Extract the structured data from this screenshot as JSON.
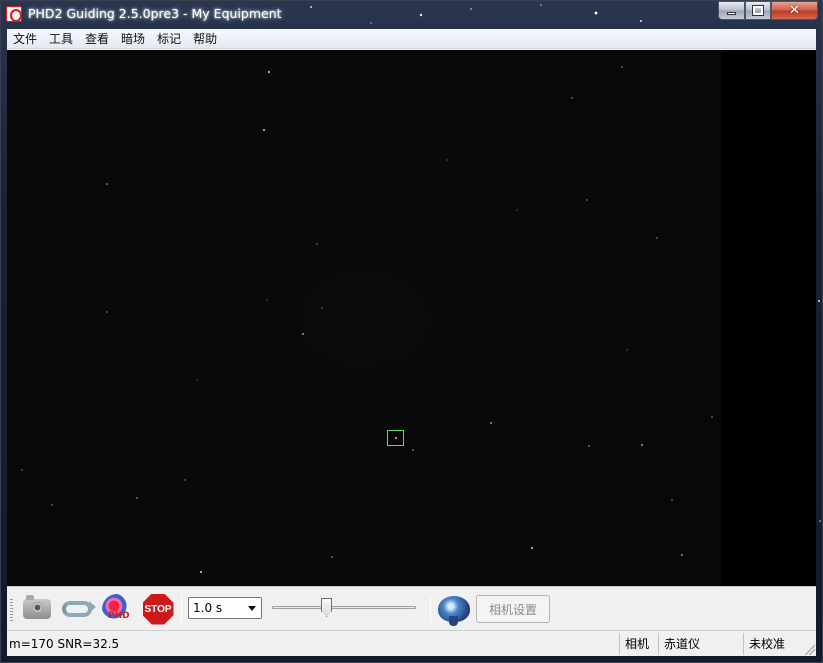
{
  "window": {
    "title": "PHD2 Guiding 2.5.0pre3 - My Equipment",
    "controls": {
      "minimize": "minimize",
      "maximize": "maximize",
      "close": "✕"
    }
  },
  "menu": [
    "文件",
    "工具",
    "查看",
    "暗场",
    "标记",
    "帮助"
  ],
  "toolbar": {
    "exposure_value": "1.0 s",
    "camera_settings_label": "相机设置",
    "stop_label": "STOP",
    "guide_logo_text": "PHD"
  },
  "status": {
    "star_info": "m=170 SNR=32.5",
    "camera": "相机",
    "mount": "赤道仪",
    "calibration": "未校准"
  },
  "colors": {
    "guide_box": "#6ad66a",
    "stop_red": "#cc1a1a",
    "viewer_bg": "#000000"
  }
}
